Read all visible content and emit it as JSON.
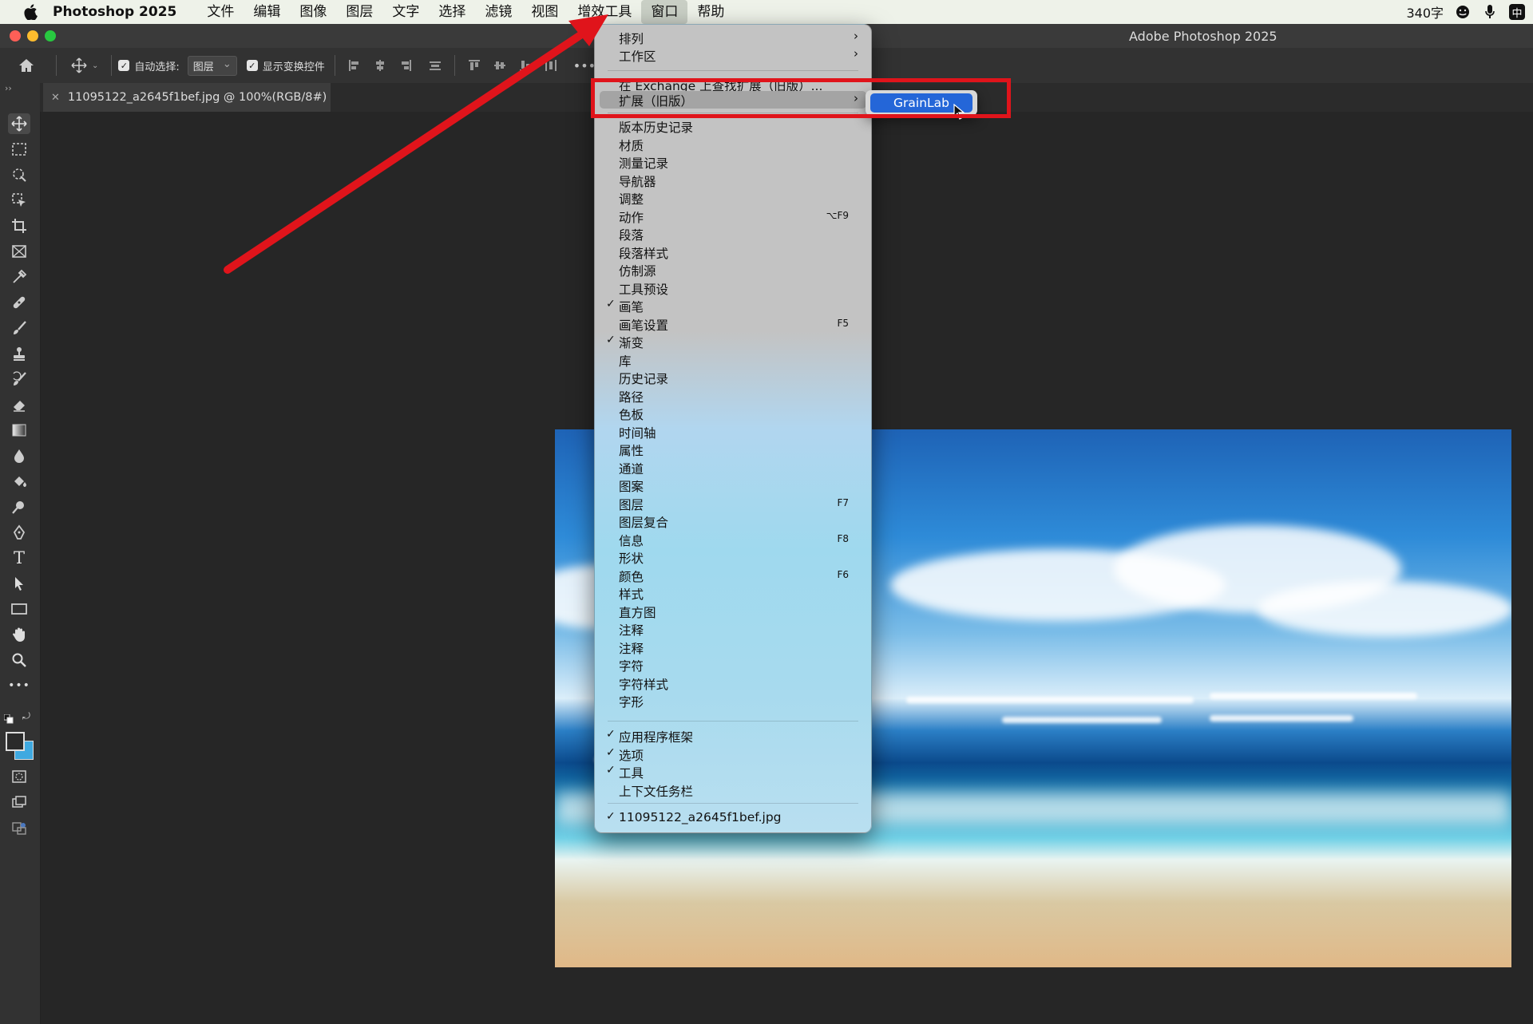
{
  "menubar": {
    "app_name": "Photoshop 2025",
    "items": [
      "文件",
      "编辑",
      "图像",
      "图层",
      "文字",
      "选择",
      "滤镜",
      "视图",
      "增效工具",
      "窗口",
      "帮助"
    ],
    "active_item": "窗口",
    "word_count": "340字",
    "input_method": "中"
  },
  "window": {
    "title": "Adobe Photoshop 2025"
  },
  "options": {
    "auto_select_label": "自动选择:",
    "auto_select_value": "图层",
    "show_transform_label": "显示变换控件"
  },
  "document": {
    "tab_label": "11095122_a2645f1bef.jpg @ 100%(RGB/8#)"
  },
  "window_menu": {
    "arrange": "排列",
    "workspace": "工作区",
    "find_exchange": "在 Exchange 上查找扩展（旧版）...",
    "extensions": "扩展（旧版）",
    "panels": [
      {
        "label": "版本历史记录",
        "checked": false,
        "shortcut": ""
      },
      {
        "label": "材质",
        "checked": false,
        "shortcut": ""
      },
      {
        "label": "测量记录",
        "checked": false,
        "shortcut": ""
      },
      {
        "label": "导航器",
        "checked": false,
        "shortcut": ""
      },
      {
        "label": "调整",
        "checked": false,
        "shortcut": ""
      },
      {
        "label": "动作",
        "checked": false,
        "shortcut": "⌥F9"
      },
      {
        "label": "段落",
        "checked": false,
        "shortcut": ""
      },
      {
        "label": "段落样式",
        "checked": false,
        "shortcut": ""
      },
      {
        "label": "仿制源",
        "checked": false,
        "shortcut": ""
      },
      {
        "label": "工具预设",
        "checked": false,
        "shortcut": ""
      },
      {
        "label": "画笔",
        "checked": true,
        "shortcut": ""
      },
      {
        "label": "画笔设置",
        "checked": false,
        "shortcut": "F5"
      },
      {
        "label": "渐变",
        "checked": true,
        "shortcut": ""
      },
      {
        "label": "库",
        "checked": false,
        "shortcut": ""
      },
      {
        "label": "历史记录",
        "checked": false,
        "shortcut": ""
      },
      {
        "label": "路径",
        "checked": false,
        "shortcut": ""
      },
      {
        "label": "色板",
        "checked": false,
        "shortcut": ""
      },
      {
        "label": "时间轴",
        "checked": false,
        "shortcut": ""
      },
      {
        "label": "属性",
        "checked": false,
        "shortcut": ""
      },
      {
        "label": "通道",
        "checked": false,
        "shortcut": ""
      },
      {
        "label": "图案",
        "checked": false,
        "shortcut": ""
      },
      {
        "label": "图层",
        "checked": false,
        "shortcut": "F7"
      },
      {
        "label": "图层复合",
        "checked": false,
        "shortcut": ""
      },
      {
        "label": "信息",
        "checked": false,
        "shortcut": "F8"
      },
      {
        "label": "形状",
        "checked": false,
        "shortcut": ""
      },
      {
        "label": "颜色",
        "checked": false,
        "shortcut": "F6"
      },
      {
        "label": "样式",
        "checked": false,
        "shortcut": ""
      },
      {
        "label": "直方图",
        "checked": false,
        "shortcut": ""
      },
      {
        "label": "注释",
        "checked": false,
        "shortcut": ""
      },
      {
        "label": "注释",
        "checked": false,
        "shortcut": ""
      },
      {
        "label": "字符",
        "checked": false,
        "shortcut": ""
      },
      {
        "label": "字符样式",
        "checked": false,
        "shortcut": ""
      },
      {
        "label": "字形",
        "checked": false,
        "shortcut": ""
      }
    ],
    "ui_items": [
      {
        "label": "应用程序框架",
        "checked": true
      },
      {
        "label": "选项",
        "checked": true
      },
      {
        "label": "工具",
        "checked": true
      },
      {
        "label": "上下文任务栏",
        "checked": false
      }
    ],
    "open_document": {
      "label": "11095122_a2645f1bef.jpg",
      "checked": true
    }
  },
  "submenu": {
    "item": "GrainLab"
  },
  "colors": {
    "annotation_red": "#e0141b",
    "selection_blue": "#2466d8",
    "menubar_bg": "#eef2e9"
  }
}
